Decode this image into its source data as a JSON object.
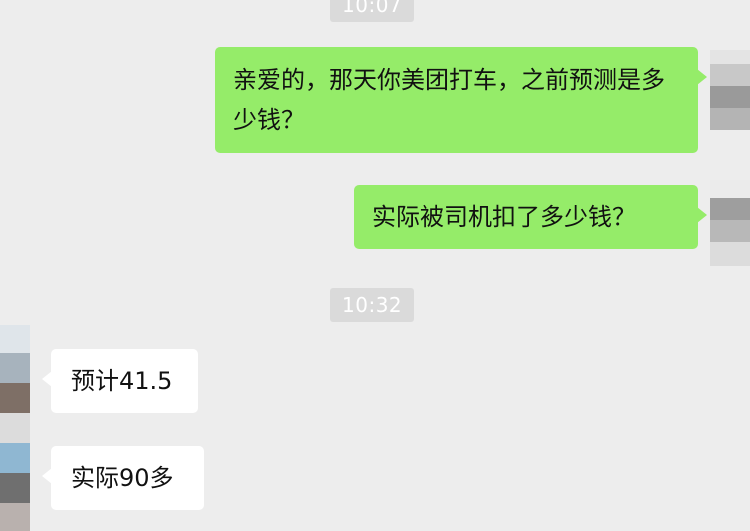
{
  "chat": {
    "timestamps": [
      "10:07",
      "10:32"
    ],
    "messages": [
      {
        "side": "sent",
        "text": "亲爱的，那天你美团打车，之前预测是多少钱？"
      },
      {
        "side": "sent",
        "text": "实际被司机扣了多少钱？"
      },
      {
        "side": "received",
        "text": "预计41.5"
      },
      {
        "side": "received",
        "text": "实际90多"
      }
    ]
  },
  "colors": {
    "background": "#ededed",
    "sent_bubble": "#95ec69",
    "received_bubble": "#ffffff",
    "timestamp_bg": "#dadada"
  }
}
